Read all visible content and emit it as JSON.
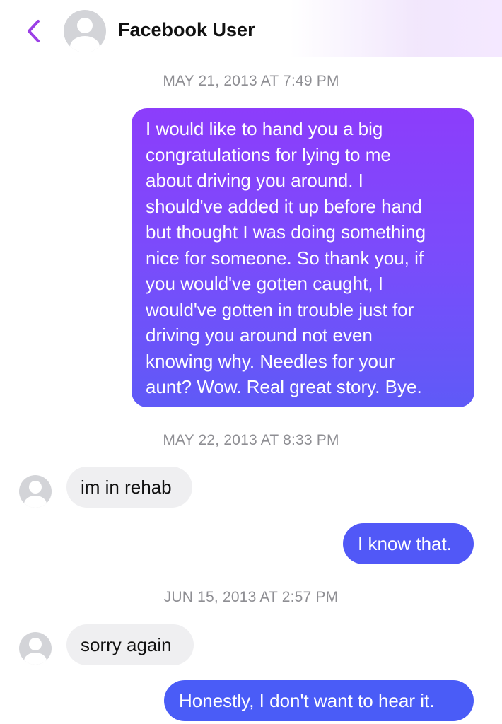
{
  "header": {
    "title": "Facebook User",
    "back_icon": "chevron-left-icon",
    "accent_color": "#9b3fe6"
  },
  "messages": [
    {
      "type": "timestamp",
      "text": "MAY 21, 2013 AT 7:49 PM"
    },
    {
      "type": "outgoing",
      "lines": [
        "I would like to hand you a big",
        "congratulations for lying to me",
        "about driving you around. I",
        "should've added it up before hand",
        "but thought I was doing something",
        "nice for someone. So thank you, if",
        "you would've gotten caught, I",
        "would've gotten in trouble just for",
        "driving you around not even",
        "knowing why. Needles for your",
        "aunt? Wow. Real great story. Bye."
      ]
    },
    {
      "type": "timestamp",
      "text": "MAY 22, 2013 AT 8:33 PM"
    },
    {
      "type": "incoming",
      "text": "im in rehab"
    },
    {
      "type": "outgoing",
      "text": "I know that."
    },
    {
      "type": "timestamp",
      "text": "JUN 15, 2013 AT 2:57 PM"
    },
    {
      "type": "incoming",
      "text": "sorry again"
    },
    {
      "type": "outgoing",
      "text": "Honestly, I don't want to hear it."
    }
  ],
  "colors": {
    "outgoing_gradient_top": "#8c3dfb",
    "outgoing_gradient_bottom": "#5f5af7",
    "outgoing_blue": "#5158f7",
    "incoming_bg": "#efeff1",
    "timestamp_text": "#8e8e93"
  }
}
